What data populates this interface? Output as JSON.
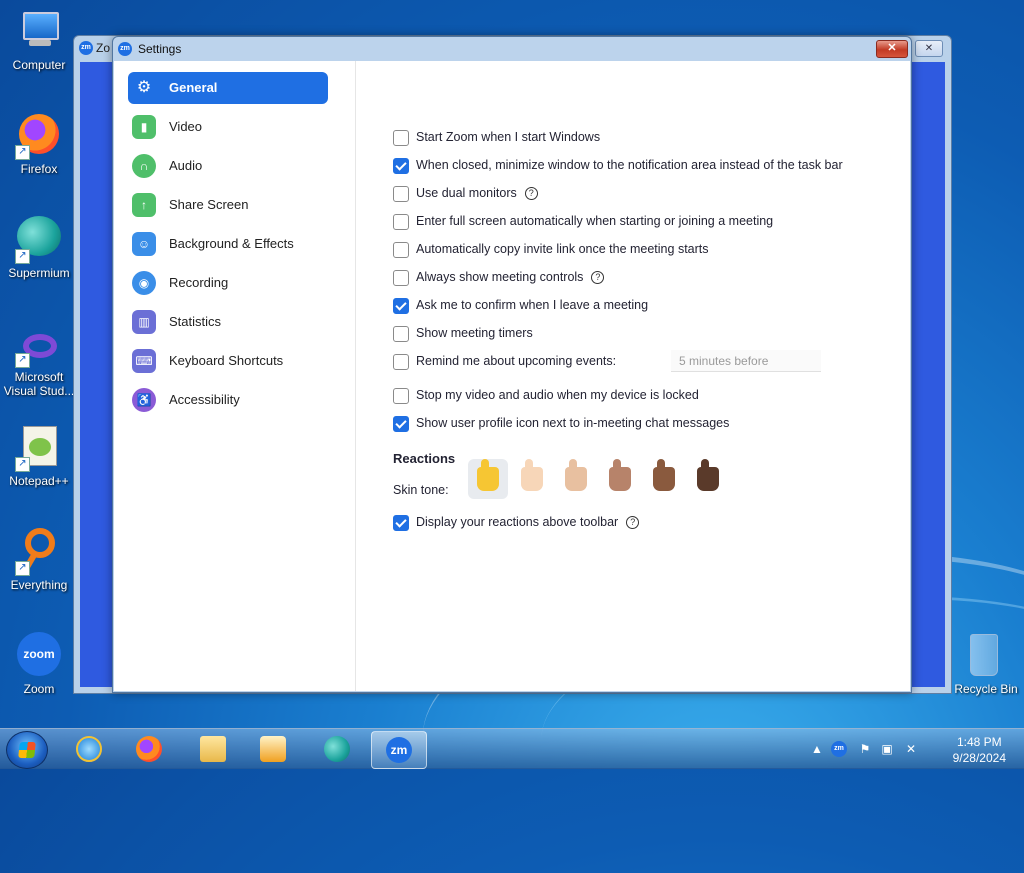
{
  "desktop": {
    "icons": [
      {
        "label": "Computer"
      },
      {
        "label": "Firefox"
      },
      {
        "label": "Supermium"
      },
      {
        "label": "Microsoft Visual Stud..."
      },
      {
        "label": "Notepad++"
      },
      {
        "label": "Everything"
      },
      {
        "label": "Zoom"
      },
      {
        "label": "Recycle Bin"
      }
    ]
  },
  "bg_window": {
    "title": "Zo"
  },
  "settings": {
    "title": "Settings",
    "zm": "zm",
    "close": "✕",
    "nav": [
      {
        "label": "General",
        "icon": "gear-icon"
      },
      {
        "label": "Video",
        "icon": "video-icon"
      },
      {
        "label": "Audio",
        "icon": "headphones-icon"
      },
      {
        "label": "Share Screen",
        "icon": "share-screen-icon"
      },
      {
        "label": "Background & Effects",
        "icon": "background-icon"
      },
      {
        "label": "Recording",
        "icon": "recording-icon"
      },
      {
        "label": "Statistics",
        "icon": "statistics-icon"
      },
      {
        "label": "Keyboard Shortcuts",
        "icon": "keyboard-icon"
      },
      {
        "label": "Accessibility",
        "icon": "accessibility-icon"
      }
    ],
    "options": [
      {
        "label": "Start Zoom when I start Windows",
        "checked": false
      },
      {
        "label": "When closed, minimize window to the notification area instead of the task bar",
        "checked": true
      },
      {
        "label": "Use dual monitors",
        "checked": false,
        "help": true
      },
      {
        "label": "Enter full screen automatically when starting or joining a meeting",
        "checked": false
      },
      {
        "label": "Automatically copy invite link once the meeting starts",
        "checked": false
      },
      {
        "label": "Always show meeting controls",
        "checked": false,
        "help": true
      },
      {
        "label": "Ask me to confirm when I leave a meeting",
        "checked": true
      },
      {
        "label": "Show meeting timers",
        "checked": false
      },
      {
        "label": "Remind me about upcoming events:",
        "checked": false
      },
      {
        "label": "Stop my video and audio when my device is locked",
        "checked": false
      },
      {
        "label": "Show user profile icon next to in-meeting chat messages",
        "checked": true
      }
    ],
    "remind_value": "5 minutes before",
    "reactions_title": "Reactions",
    "skin_tone_label": "Skin tone:",
    "skin_tones": [
      "#f6c633",
      "#f7d6b8",
      "#e8c0a0",
      "#b7836a",
      "#8a5a3e",
      "#5a3a2a"
    ],
    "selected_skin_tone": 0,
    "display_reactions": {
      "label": "Display your reactions above toolbar",
      "checked": true
    },
    "help_glyph": "?"
  },
  "taskbar": {
    "zm_label": "zm",
    "time": "1:48 PM",
    "date": "9/28/2024",
    "tray_zm": "zm"
  }
}
